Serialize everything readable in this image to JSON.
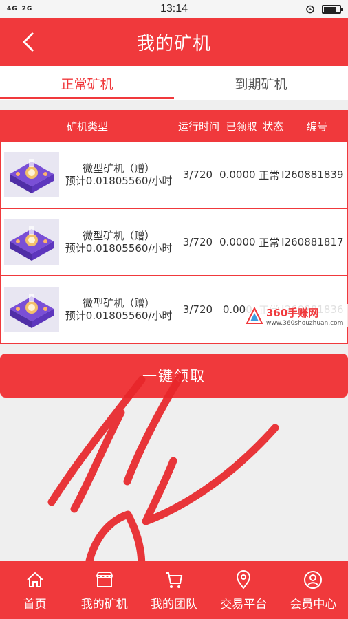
{
  "status_bar": {
    "signal": [
      "4G",
      "2G"
    ],
    "time": "13:14"
  },
  "header": {
    "back_icon": "chevron-left-icon",
    "title": "我的矿机"
  },
  "tabs": [
    {
      "label": "正常矿机",
      "active": true
    },
    {
      "label": "到期矿机",
      "active": false
    }
  ],
  "table": {
    "columns": [
      "矿机类型",
      "运行时间",
      "已领取",
      "状态",
      "编号"
    ],
    "rows": [
      {
        "name": "微型矿机（赠）",
        "estimate": "预计0.01805560/小时",
        "runtime": "3/720",
        "claimed": "0.0000",
        "status": "正常",
        "id": "I260881839"
      },
      {
        "name": "微型矿机（赠）",
        "estimate": "预计0.01805560/小时",
        "runtime": "3/720",
        "claimed": "0.0000",
        "status": "正常",
        "id": "I260881817"
      },
      {
        "name": "微型矿机（赠）",
        "estimate": "预计0.01805560/小时",
        "runtime": "3/720",
        "claimed": "0.000",
        "status": "正常",
        "id": "I260881836"
      }
    ]
  },
  "watermark": {
    "title": "360手赚网",
    "url": "www.360shouzhuan.com"
  },
  "claim_button": "一键领取",
  "bottom_nav": [
    {
      "label": "首页",
      "icon": "home-icon"
    },
    {
      "label": "我的矿机",
      "icon": "store-icon"
    },
    {
      "label": "我的团队",
      "icon": "cart-icon"
    },
    {
      "label": "交易平台",
      "icon": "location-pin-icon"
    },
    {
      "label": "会员中心",
      "icon": "user-icon"
    }
  ],
  "colors": {
    "brand_red": "#f0393c",
    "background": "#efefef"
  }
}
